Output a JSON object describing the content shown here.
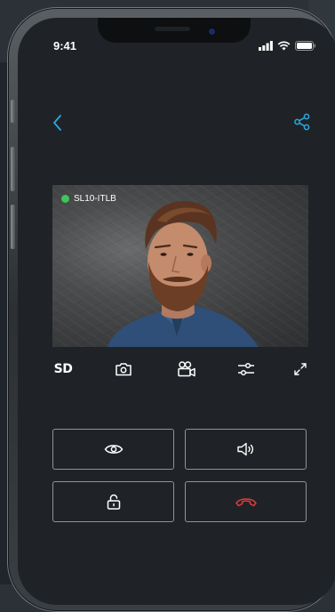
{
  "status_bar": {
    "time": "9:41"
  },
  "camera": {
    "name": "SL10-ITLB",
    "status_color": "#3ec55b"
  },
  "toolbar": {
    "sd_label": "SD"
  },
  "colors": {
    "accent": "#2aa8e0",
    "hangup": "#e23a3a",
    "frame": "#8f9498"
  },
  "icons": {
    "back": "chevron-left-icon",
    "share": "share-icon",
    "snapshot": "camera-icon",
    "record": "video-record-icon",
    "settings": "sliders-icon",
    "fullscreen": "expand-icon",
    "view": "eye-icon",
    "speaker": "speaker-icon",
    "unlock": "unlock-icon",
    "hangup": "phone-hangup-icon"
  }
}
